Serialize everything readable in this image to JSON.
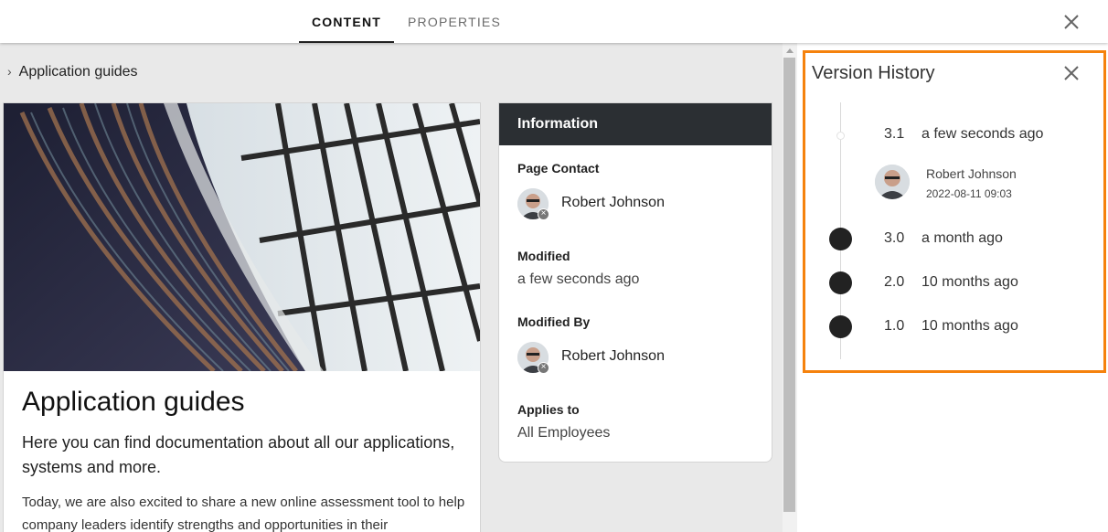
{
  "tabs": [
    {
      "label": "CONTENT",
      "active": true
    },
    {
      "label": "PROPERTIES",
      "active": false
    }
  ],
  "breadcrumb": {
    "chevron": "›",
    "label": "Application guides"
  },
  "article": {
    "title": "Application guides",
    "lead": "Here you can find documentation about all our applications, systems and more.",
    "body": "Today, we are also excited to share a new online assessment tool to help company leaders identify strengths and opportunities in their"
  },
  "information": {
    "header": "Information",
    "page_contact_label": "Page Contact",
    "page_contact_name": "Robert Johnson",
    "modified_label": "Modified",
    "modified_value": "a few seconds ago",
    "modified_by_label": "Modified By",
    "modified_by_name": "Robert Johnson",
    "applies_to_label": "Applies to",
    "applies_to_value": "All Employees"
  },
  "version_history": {
    "title": "Version History",
    "highlight_color": "#f5820d",
    "versions": [
      {
        "number": "3.1",
        "time": "a few seconds ago",
        "author": "Robert Johnson",
        "date": "2022-08-11 09:03"
      },
      {
        "number": "3.0",
        "time": "a month ago"
      },
      {
        "number": "2.0",
        "time": "10 months ago"
      },
      {
        "number": "1.0",
        "time": "10 months ago"
      }
    ]
  },
  "icons": {
    "close": "close-icon",
    "chevron": "chevron-right-icon",
    "avatar_badge": "remove-badge-icon"
  }
}
